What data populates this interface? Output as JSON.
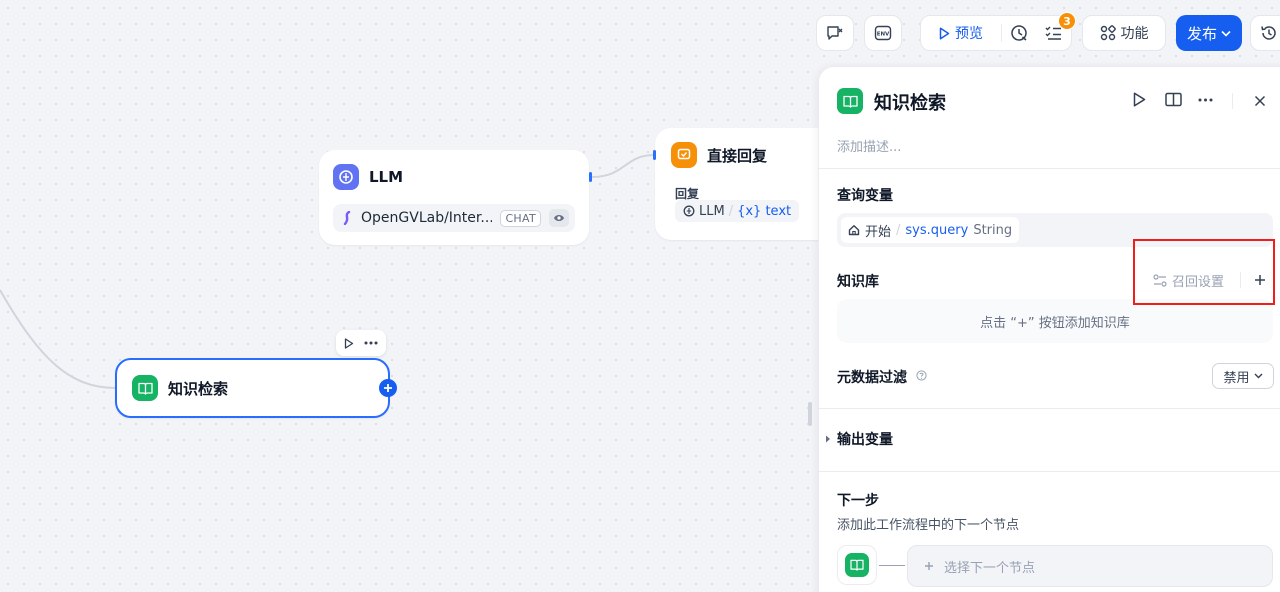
{
  "canvas": {
    "llm_node": {
      "title": "LLM",
      "model": "OpenGVLab/Inter...",
      "badge": "CHAT"
    },
    "reply_node": {
      "title": "直接回复",
      "field_label": "回复",
      "source": "LLM",
      "separator": "/",
      "var": "{x} text"
    },
    "knowledge_node": {
      "title": "知识检索"
    }
  },
  "toolbar": {
    "preview_label": "预览",
    "checklist_count": "3",
    "features_label": "功能",
    "publish_label": "发布",
    "env_icon_text": "ENV"
  },
  "panel": {
    "title": "知识检索",
    "description_placeholder": "添加描述...",
    "query_section": {
      "title": "查询变量",
      "chip_source": "开始",
      "chip_sep": "/",
      "chip_var": "sys.query",
      "chip_type": "String"
    },
    "kb_section": {
      "title": "知识库",
      "recall_settings_label": "召回设置",
      "empty_hint": "点击 “+” 按钮添加知识库"
    },
    "metadata_section": {
      "title": "元数据过滤",
      "select_value": "禁用"
    },
    "output_section": {
      "title": "输出变量"
    },
    "next_step": {
      "title": "下一步",
      "description": "添加此工作流程中的下一个节点",
      "select_label": "选择下一个节点"
    }
  },
  "colors": {
    "accent": "#155eef",
    "knowledge_green": "#16b364",
    "llm_purple": "#6172f3",
    "reply_orange": "#f79009",
    "highlight_red": "#f01d1d"
  }
}
